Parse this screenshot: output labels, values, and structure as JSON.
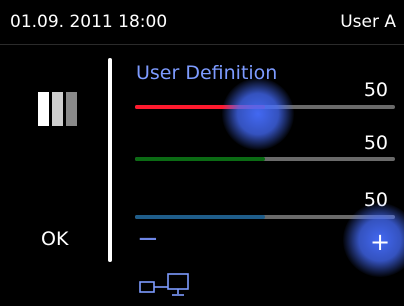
{
  "status_bar": {
    "datetime": "01.09. 2011 18:00",
    "user": "User A"
  },
  "left_panel": {
    "ok_label": "OK"
  },
  "user_definition": {
    "title": "User Definition",
    "sliders": [
      {
        "name": "red",
        "value": "50",
        "level": 0.5,
        "color": "#ff1a2e"
      },
      {
        "name": "green",
        "value": "50",
        "level": 0.5,
        "color": "#0b6b14"
      },
      {
        "name": "blue",
        "value": "50",
        "level": 0.5,
        "color": "#1f5d8a"
      }
    ],
    "minus_label": "−",
    "plus_label": "+"
  },
  "swatch_colors": [
    "#ffffff",
    "#cfcfcf",
    "#8a8a8a"
  ],
  "accent_color": "#7d9bff",
  "icons": {
    "bottom": "connection-icon"
  }
}
